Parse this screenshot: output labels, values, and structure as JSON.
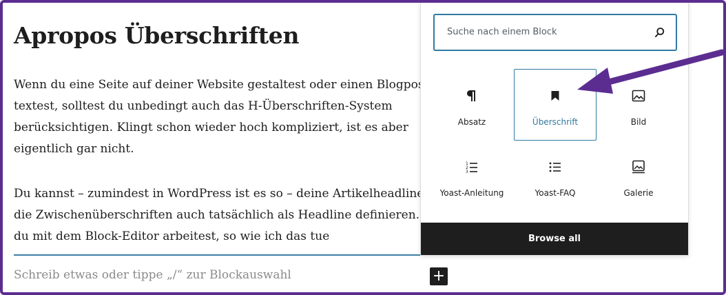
{
  "editor": {
    "heading": "Apropos Überschriften",
    "paragraph1": [
      "Wenn du eine Seite auf deiner Website gestaltest oder einen Blogpost",
      "textest, solltest du unbedingt auch das H-Überschriften-System",
      "berücksichtigen. Klingt schon wieder hoch kompliziert, ist es aber",
      "eigentlich gar nicht."
    ],
    "paragraph2": [
      "Du kannst – zumindest in WordPress ist es so – deine Artikelheadline u",
      "die Zwischenüberschriften auch tatsächlich als Headline definieren. W",
      "du mit dem Block-Editor arbeitest, so wie ich das tue"
    ],
    "placeholder": "Schreib etwas oder tippe „/“ zur Blockauswahl",
    "add_block_symbol": "+"
  },
  "inserter": {
    "search_placeholder": "Suche nach einem Block",
    "blocks": [
      {
        "label": "Absatz",
        "icon": "paragraph-icon",
        "selected": false
      },
      {
        "label": "Überschrift",
        "icon": "heading-bookmark-icon",
        "selected": true
      },
      {
        "label": "Bild",
        "icon": "image-icon",
        "selected": false
      },
      {
        "label": "Yoast-Anleitung",
        "icon": "numbered-list-icon",
        "selected": false
      },
      {
        "label": "Yoast-FAQ",
        "icon": "bulleted-list-icon",
        "selected": false
      },
      {
        "label": "Galerie",
        "icon": "gallery-icon",
        "selected": false
      }
    ],
    "browse_all": "Browse all"
  },
  "colors": {
    "frame_border": "#5c2d91",
    "arrow": "#5c2d91",
    "accent": "#2f7aa0",
    "text": "#1e1e1e"
  }
}
